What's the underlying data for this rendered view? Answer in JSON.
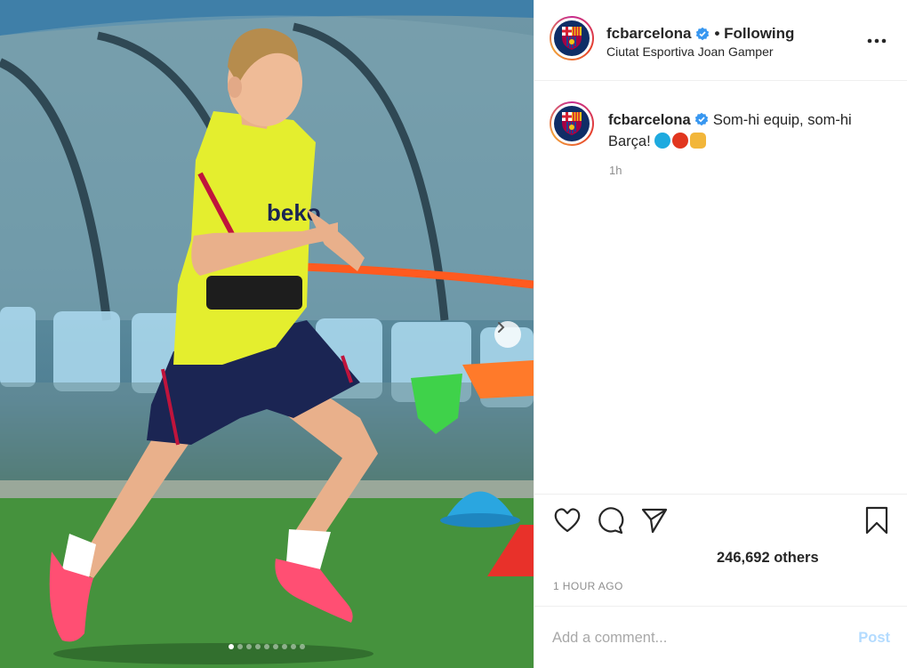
{
  "post": {
    "username": "fcbarcelona",
    "follow_status": "• Following",
    "location": "Ciutat Esportiva Joan Gamper",
    "caption_text": "Som-hi equip, som-hi Barça!",
    "caption_time": "1h",
    "likes_text": "246,692 others",
    "time_ago": "1 HOUR AGO",
    "comment_placeholder": "Add a comment...",
    "post_label": "Post"
  },
  "carousel": {
    "slides": 9,
    "active_index": 0
  },
  "emojis": [
    "blue-circle",
    "red-circle",
    "raised-fist"
  ],
  "colors": {
    "verified": "#3897f0",
    "post_button": "#b3dbff",
    "blue_circle": "#1eaadf",
    "red_circle": "#e1361f",
    "fist": "#f2b63a",
    "jersey": "#e6f02e",
    "boots": "#ff3f6a"
  }
}
